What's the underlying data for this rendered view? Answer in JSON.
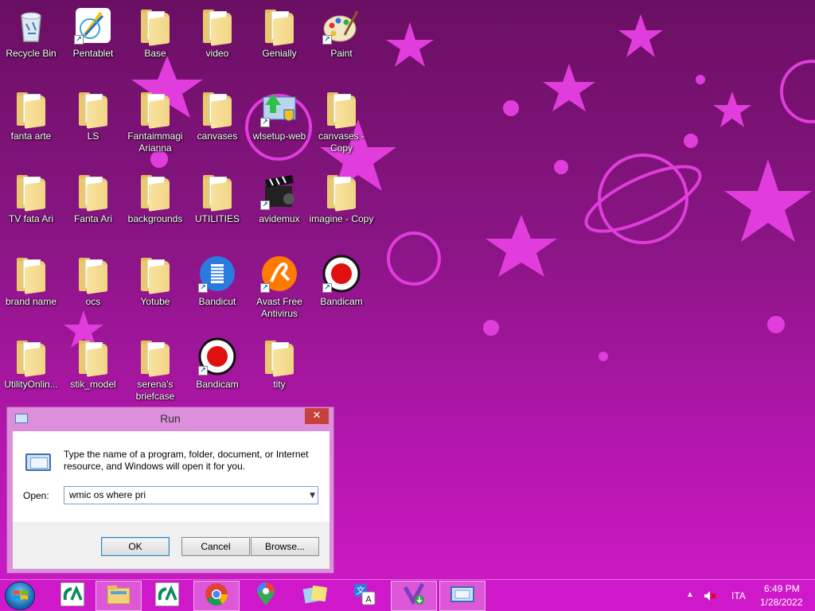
{
  "desktop": {
    "icons": [
      {
        "label": "Recycle Bin",
        "type": "recycle",
        "name": "recycle-bin-icon"
      },
      {
        "label": "Pentablet",
        "type": "app",
        "name": "pentablet-app-icon"
      },
      {
        "label": "Base",
        "type": "folder",
        "name": "folder-icon"
      },
      {
        "label": "video",
        "type": "folder",
        "name": "folder-icon"
      },
      {
        "label": "Genially",
        "type": "folder",
        "name": "folder-icon"
      },
      {
        "label": "Paint",
        "type": "paint",
        "name": "paint-palette-icon"
      },
      {
        "label": "fanta arte",
        "type": "folder",
        "name": "folder-icon"
      },
      {
        "label": "LS",
        "type": "folder",
        "name": "folder-icon"
      },
      {
        "label": "Fantaimmagi Arianna",
        "type": "folder",
        "name": "folder-icon"
      },
      {
        "label": "canvases",
        "type": "folder",
        "name": "folder-icon"
      },
      {
        "label": "wlsetup-web",
        "type": "installer",
        "name": "installer-shield-icon"
      },
      {
        "label": "canvases - Copy",
        "type": "folder",
        "name": "folder-icon"
      },
      {
        "label": "TV fata Ari",
        "type": "folder",
        "name": "folder-icon"
      },
      {
        "label": "Fanta Ari",
        "type": "folder",
        "name": "folder-icon"
      },
      {
        "label": "backgrounds",
        "type": "folder",
        "name": "folder-icon"
      },
      {
        "label": "UTILITIES",
        "type": "folder",
        "name": "folder-icon"
      },
      {
        "label": "avidemux",
        "type": "clapper",
        "name": "clapperboard-icon"
      },
      {
        "label": "imagine - Copy",
        "type": "folder",
        "name": "folder-icon"
      },
      {
        "label": "brand name",
        "type": "folder",
        "name": "folder-icon"
      },
      {
        "label": "ocs",
        "type": "folder",
        "name": "folder-icon"
      },
      {
        "label": "Yotube",
        "type": "folder",
        "name": "folder-icon"
      },
      {
        "label": "Bandicut",
        "type": "bandicut",
        "name": "bandicut-film-icon"
      },
      {
        "label": "Avast Free Antivirus",
        "type": "avast",
        "name": "avast-icon"
      },
      {
        "label": "Bandicam",
        "type": "bandicam",
        "name": "bandicam-record-icon"
      },
      {
        "label": "UtilityOnlin...",
        "type": "folder",
        "name": "folder-icon"
      },
      {
        "label": "stik_model",
        "type": "folder",
        "name": "folder-icon"
      },
      {
        "label": "serena's briefcase",
        "type": "folder",
        "name": "folder-icon"
      },
      {
        "label": "Bandicam",
        "type": "bandicam",
        "name": "bandicam-record-icon"
      },
      {
        "label": "tity",
        "type": "folder",
        "name": "folder-icon"
      }
    ]
  },
  "run_dialog": {
    "title": "Run",
    "close_glyph": "✕",
    "description": "Type the name of a program, folder, document, or Internet resource, and Windows will open it for you.",
    "open_label": "Open:",
    "input_value": "wmic os where pri",
    "dropdown_glyph": "▼",
    "ok_label": "OK",
    "cancel_label": "Cancel",
    "browse_label": "Browse..."
  },
  "taskbar": {
    "items": [
      {
        "name": "credit-agricole-icon",
        "active": false
      },
      {
        "name": "file-explorer-icon",
        "active": true
      },
      {
        "name": "credit-agricole-icon",
        "active": false
      },
      {
        "name": "chrome-icon",
        "active": true
      },
      {
        "name": "google-maps-icon",
        "active": false
      },
      {
        "name": "sticky-notes-icon",
        "active": false
      },
      {
        "name": "translate-icon",
        "active": false
      },
      {
        "name": "visual-studio-installer-icon",
        "active": true
      },
      {
        "name": "run-dialog-icon",
        "active": true
      }
    ],
    "tray": {
      "chevron": "▲",
      "language": "ITA",
      "time": "6:49 PM",
      "date": "1/28/2022"
    }
  },
  "colors": {
    "taskbar": "#cf18c9",
    "dialog_frame": "#dd8fdc",
    "close_button": "#c7403a",
    "wallpaper_accent": "#e23ee0"
  }
}
